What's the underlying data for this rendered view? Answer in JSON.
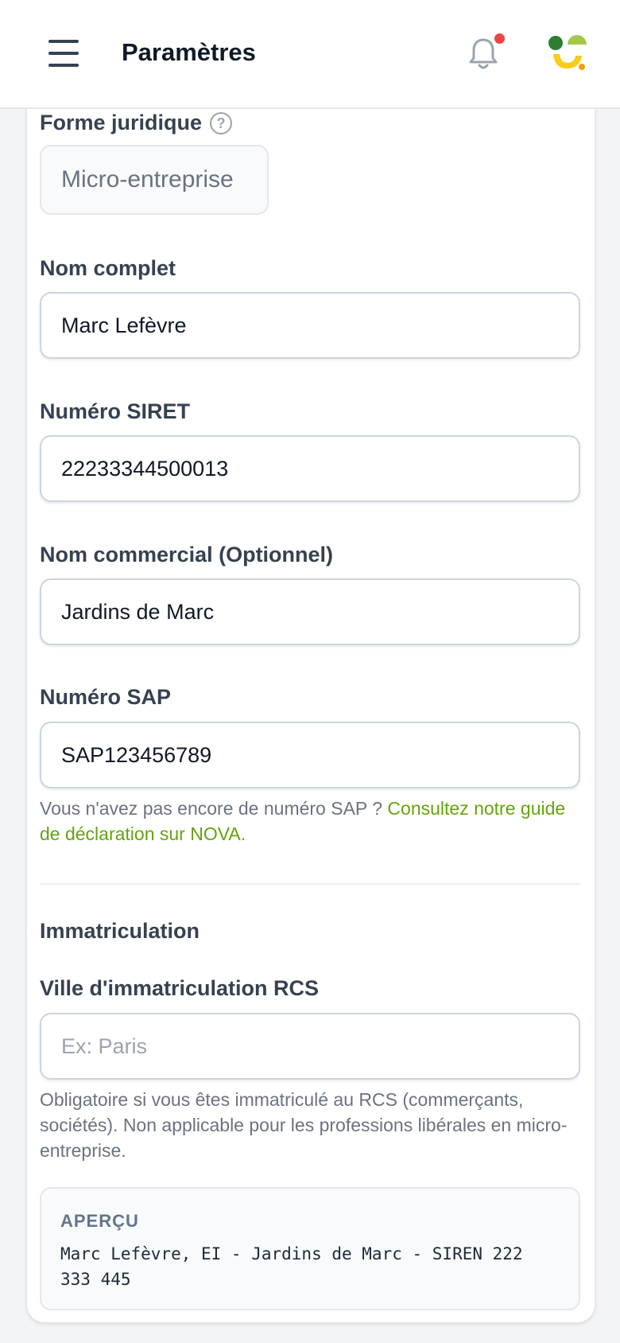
{
  "header": {
    "title": "Paramètres",
    "menu_icon": "hamburger-menu-icon",
    "notification_icon": "bell-icon",
    "notification_dot_color": "#ef4444",
    "logo_icon": "app-logo-icon"
  },
  "form": {
    "legal_form": {
      "label": "Forme juridique",
      "help_icon": "question-circle-icon",
      "help_glyph": "?",
      "value": "Micro-entreprise"
    },
    "full_name": {
      "label": "Nom complet",
      "value": "Marc Lefèvre"
    },
    "siret": {
      "label": "Numéro SIRET",
      "value": "22233344500013"
    },
    "trade_name": {
      "label": "Nom commercial (Optionnel)",
      "value": "Jardins de Marc"
    },
    "sap": {
      "label": "Numéro SAP",
      "value": "SAP123456789",
      "hint_text": "Vous n'avez pas encore de numéro SAP ? ",
      "hint_link": "Consultez notre guide de déclaration sur NOVA."
    },
    "registration": {
      "section_title": "Immatriculation",
      "rcs_label": "Ville d'immatriculation RCS",
      "rcs_value": "",
      "rcs_placeholder": "Ex: Paris",
      "rcs_hint": "Obligatoire si vous êtes immatriculé au RCS (commerçants, sociétés). Non applicable pour les professions libérales en micro-entreprise."
    },
    "preview": {
      "title": "APERÇU",
      "text": "Marc Lefèvre, EI - Jardins de Marc - SIREN 222 333 445"
    }
  },
  "colors": {
    "accent_link": "#65a30d",
    "logo_green": "#2e7d32",
    "logo_yellow": "#facc15",
    "logo_olive": "#a3c94a",
    "logo_dot": "#f59e0b"
  }
}
